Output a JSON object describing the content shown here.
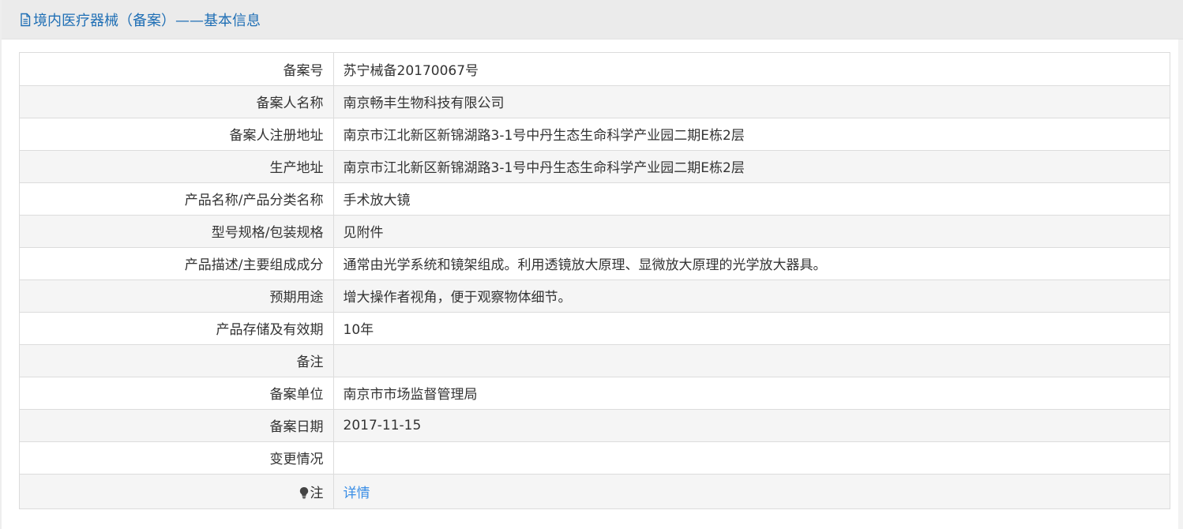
{
  "header": {
    "title": "境内医疗器械（备案）——基本信息",
    "icon": "document-icon"
  },
  "colors": {
    "title": "#1f6fb5",
    "link": "#3a8ee6",
    "header_bg": "#ebebeb",
    "row_alt": "#f5f5f5",
    "border": "#dcdcdc"
  },
  "rows": [
    {
      "label": "备案号",
      "value": "苏宁械备20170067号"
    },
    {
      "label": "备案人名称",
      "value": "南京畅丰生物科技有限公司"
    },
    {
      "label": "备案人注册地址",
      "value": "南京市江北新区新锦湖路3-1号中丹生态生命科学产业园二期E栋2层"
    },
    {
      "label": "生产地址",
      "value": "南京市江北新区新锦湖路3-1号中丹生态生命科学产业园二期E栋2层"
    },
    {
      "label": "产品名称/产品分类名称",
      "value": "手术放大镜"
    },
    {
      "label": "型号规格/包装规格",
      "value": "见附件"
    },
    {
      "label": "产品描述/主要组成成分",
      "value": "通常由光学系统和镜架组成。利用透镜放大原理、显微放大原理的光学放大器具。"
    },
    {
      "label": "预期用途",
      "value": "增大操作者视角，便于观察物体细节。"
    },
    {
      "label": "产品存储及有效期",
      "value": "10年"
    },
    {
      "label": "备注",
      "value": ""
    },
    {
      "label": "备案单位",
      "value": "南京市市场监督管理局"
    },
    {
      "label": "备案日期",
      "value": "2017-11-15"
    },
    {
      "label": "变更情况",
      "value": ""
    }
  ],
  "note": {
    "label": "注",
    "icon": "lightbulb-icon",
    "link_text": "详情"
  }
}
